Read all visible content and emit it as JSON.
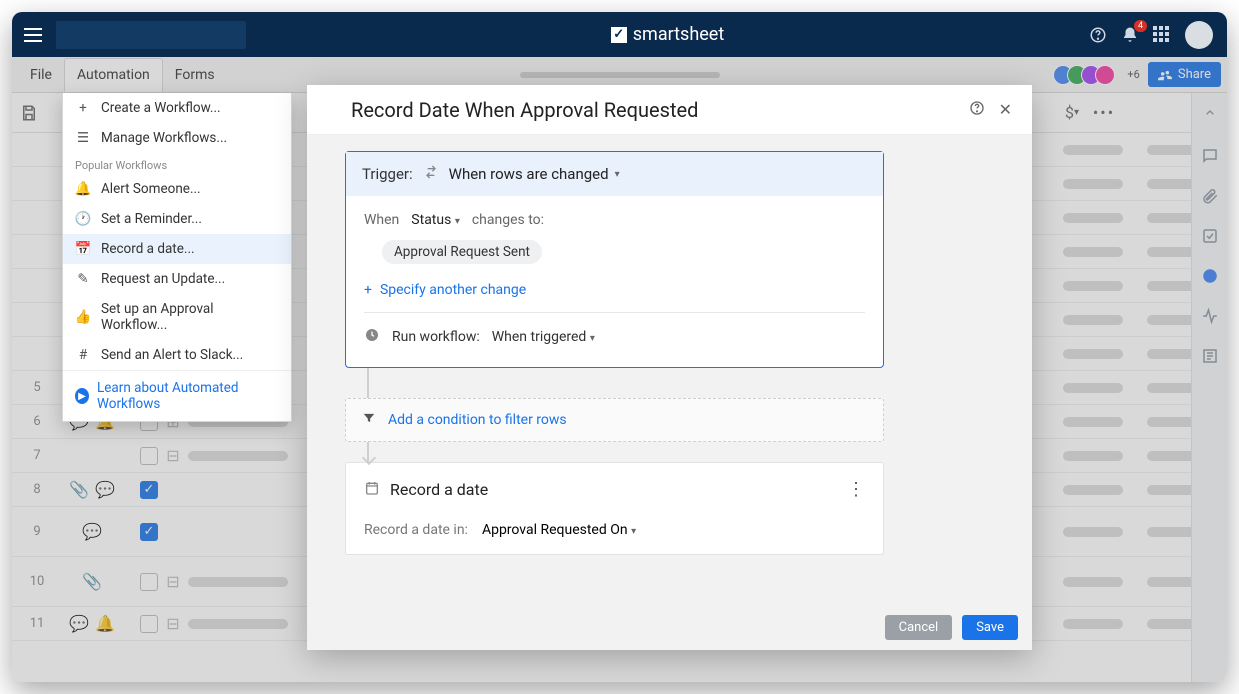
{
  "brand": "smartsheet",
  "notif_count": "4",
  "menubar": {
    "file": "File",
    "automation": "Automation",
    "forms": "Forms"
  },
  "collab_more": "+6",
  "share": "Share",
  "dropdown": {
    "create": "Create a Workflow...",
    "manage": "Manage Workflows...",
    "section": "Popular Workflows",
    "alert": "Alert Someone...",
    "reminder": "Set a Reminder...",
    "record": "Record a date...",
    "update": "Request an Update...",
    "approval": "Set up an Approval Workflow...",
    "slack": "Send an Alert to Slack...",
    "learn": "Learn about Automated Workflows"
  },
  "modal": {
    "title": "Record Date When Approval Requested",
    "trigger_label": "Trigger:",
    "trigger_value": "When rows are changed",
    "when": "When",
    "field": "Status",
    "changes_to": "changes to:",
    "chip": "Approval Request Sent",
    "specify": "Specify another change",
    "run_label": "Run workflow:",
    "run_value": "When triggered",
    "condition": "Add a condition to filter rows",
    "action_title": "Record a date",
    "action_label": "Record a date in:",
    "action_value": "Approval Requested On",
    "cancel": "Cancel",
    "save": "Save"
  },
  "rows": [
    "5",
    "6",
    "7",
    "8",
    "9",
    "10",
    "11"
  ],
  "toolbar_currency": "$"
}
